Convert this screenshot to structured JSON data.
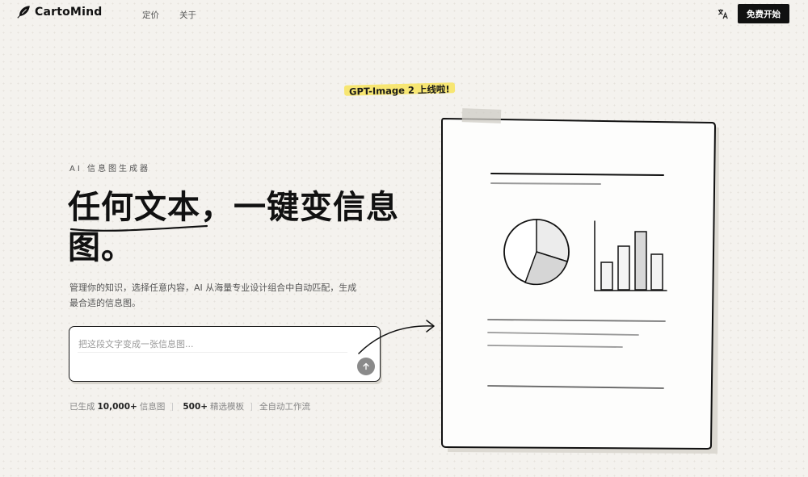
{
  "brand": {
    "name": "CartoMind",
    "icon": "feather-icon"
  },
  "nav": {
    "links": [
      "定价",
      "关于"
    ],
    "lang_icon": "translate-icon",
    "cta_label": "免费开始"
  },
  "badge": {
    "text": "GPT-Image 2 上线啦!"
  },
  "hero": {
    "eyebrow": "AI 信息图生成器",
    "title": "任何文本，一键变信息图。",
    "subtitle": "管理你的知识，选择任意内容，AI 从海量专业设计组合中自动匹配，生成最合适的信息图。"
  },
  "prompt": {
    "placeholder": "把这段文字变成一张信息图...",
    "value": "",
    "send_icon": "arrow-up-icon"
  },
  "stats": {
    "generated_prefix": "已生成",
    "generated_count": "10,000+",
    "generated_suffix": "信息图",
    "templates_count": "500+",
    "templates_label": "精选模板",
    "workflow_label": "全自动工作流"
  },
  "colors": {
    "accent": "#111111",
    "highlight": "#f7e56a",
    "background": "#f4f2ee"
  }
}
